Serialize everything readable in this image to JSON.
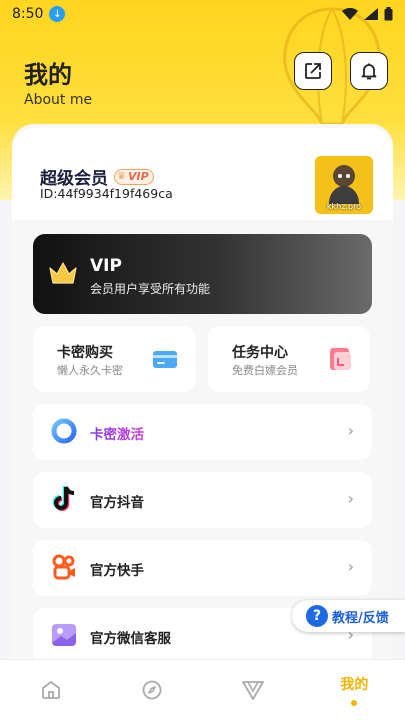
{
  "status_bar": {
    "time": "8:50"
  },
  "header": {
    "title": "我的",
    "subtitle": "About me"
  },
  "user": {
    "name": "超级会员",
    "vip_badge": "VIP",
    "id": "ID:44f9934f19f469ca",
    "avatar_text": "kkhz.pro"
  },
  "vip_card": {
    "title": "VIP",
    "description": "会员用户享受所有功能"
  },
  "quick_cards": [
    {
      "title": "卡密购买",
      "subtitle": "懒人永久卡密"
    },
    {
      "title": "任务中心",
      "subtitle": "免费白嫖会员"
    }
  ],
  "menu_rows": [
    {
      "label": "卡密激活"
    },
    {
      "label": "官方抖音"
    },
    {
      "label": "官方快手"
    },
    {
      "label": "官方微信客服"
    }
  ],
  "feedback": {
    "label": "教程/反馈"
  },
  "bottom_nav": {
    "active_label": "我的"
  },
  "colors": {
    "accent_yellow": "#ffd51f",
    "nav_active": "#f0b400",
    "feedback_blue": "#1e6ae4"
  }
}
